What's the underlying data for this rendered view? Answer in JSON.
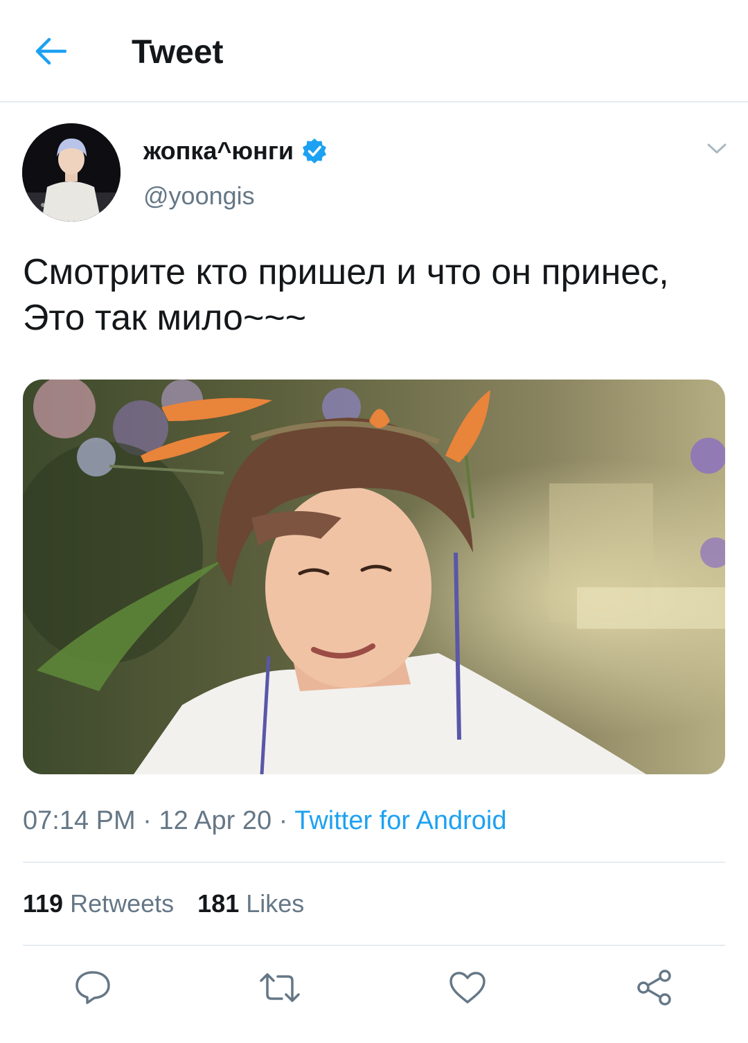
{
  "header": {
    "title": "Tweet",
    "back_icon": "arrow-left-icon",
    "accent": "#1da1f2"
  },
  "author": {
    "display_name": "жопка^юнги",
    "handle": "@yoongis",
    "verified": true,
    "verified_icon": "verified-badge-icon"
  },
  "tweet": {
    "text": "Смотрите кто пришел и что он принес, Это так мило~~~"
  },
  "meta": {
    "time": "07:14 PM",
    "separator": " · ",
    "date": "12 Apr 20",
    "source": "Twitter for Android"
  },
  "stats": {
    "retweets_count": "119",
    "retweets_label": "Retweets",
    "likes_count": "181",
    "likes_label": "Likes"
  },
  "actions": [
    "reply-icon",
    "retweet-icon",
    "like-icon",
    "share-icon"
  ],
  "colors": {
    "text": "#14171a",
    "secondary": "#657786",
    "divider": "#e6ecf0",
    "link": "#1da1f2"
  }
}
